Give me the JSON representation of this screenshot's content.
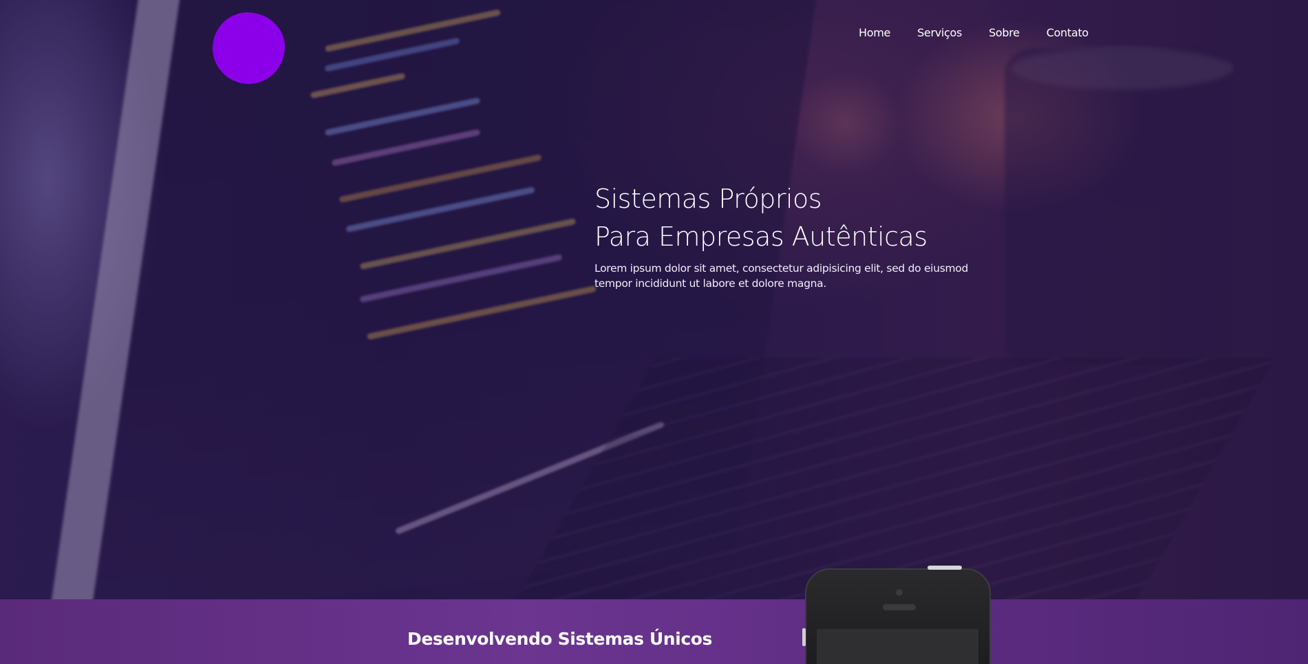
{
  "nav": {
    "items": [
      {
        "label": "Home"
      },
      {
        "label": "Serviços"
      },
      {
        "label": "Sobre"
      },
      {
        "label": "Contato"
      }
    ]
  },
  "hero": {
    "headline_line1": "Sistemas Próprios",
    "headline_line2": "Para Empresas Autênticas",
    "lead": "Lorem ipsum dolor sit amet, consectetur adipisicing elit, sed do eiusmod tempor incididunt ut labore et dolore magna."
  },
  "band": {
    "title": "Desenvolvendo Sistemas Únicos"
  },
  "colors": {
    "logo": "#8b00e8",
    "band": "#6b3590",
    "overlay": "#2a1a4e"
  },
  "icons": {
    "logo": "logo-mark",
    "phone": "smartphone-illustration"
  }
}
